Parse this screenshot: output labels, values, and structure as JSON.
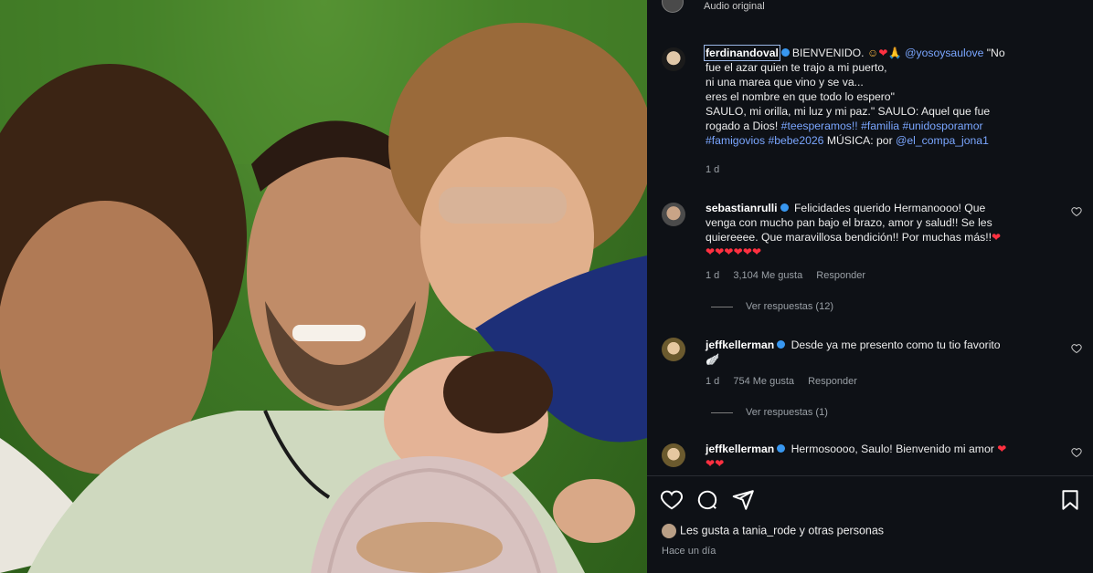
{
  "top": {
    "audio_label": "Audio original"
  },
  "caption": {
    "username": "ferdinandoval",
    "line1_after": "BIENVENIDO.",
    "mention1": "@yosoysaulove",
    "line1_quote": "\"No",
    "line2": "fue el azar quien te trajo a mi puerto,",
    "line3": "ni una marea que vino y se va...",
    "line4": "eres el nombre en que todo lo espero\"",
    "line5": "SAULO, mi orilla, mi luz y mi paz.\" SAULO: Aquel que fue",
    "line6_pre": "rogado a Dios!",
    "hashtag1": "#teesperamos!!",
    "hashtag2": "#familia",
    "hashtag3": "#unidosporamor",
    "hashtag4": "#famigovios",
    "hashtag5": "#bebe2026",
    "music_label": "MÚSICA: por",
    "mention2": "@el_compa_jona1",
    "time": "1 d"
  },
  "comments": [
    {
      "username": "sebastianrulli",
      "line1": "Felicidades querido Hermanoooo! Que",
      "line2": "venga con mucho pan bajo el brazo, amor y salud!! Se les",
      "line3": "quiereeee. Que maravillosa bendición!! Por muchas más!!",
      "hearts": "❤❤❤❤❤❤",
      "time": "1 d",
      "likes": "3,104 Me gusta",
      "reply": "Responder",
      "view_replies": "Ver respuestas (12)"
    },
    {
      "username": "jeffkellerman",
      "line1": "Desde ya me presento como tu tio favorito",
      "emoji": "🪽",
      "time": "1 d",
      "likes": "754 Me gusta",
      "reply": "Responder",
      "view_replies": "Ver respuestas (1)"
    },
    {
      "username": "jeffkellerman",
      "line1": "Hermosoooo, Saulo! Bienvenido mi amor",
      "hearts": "❤❤",
      "time": ""
    }
  ],
  "footer": {
    "likes_text": "Les gusta a tania_rode y otras personas",
    "time_ago": "Hace un día"
  },
  "icons": [
    "like-icon",
    "comment-icon",
    "share-icon",
    "save-icon"
  ],
  "colors": {
    "panel_bg": "#0e1116",
    "link": "#7aa6ff",
    "heart": "#ff3040",
    "verified": "#3897f0"
  }
}
